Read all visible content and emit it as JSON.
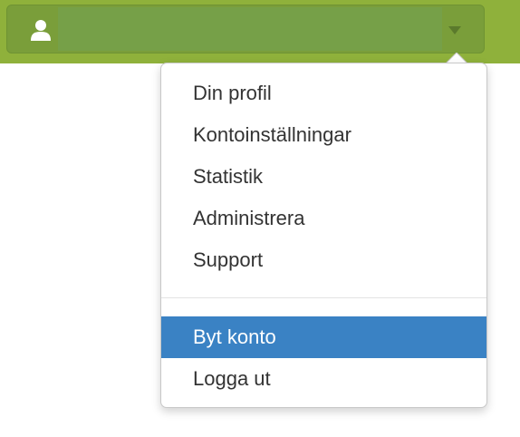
{
  "header": {
    "user_icon": "user-icon",
    "username": "",
    "caret_icon": "caret-down-icon",
    "colors": {
      "bar": "#8fb13b",
      "button": "#7a9e3a",
      "name_field": "#76a048"
    }
  },
  "menu": {
    "items": [
      {
        "label": "Din profil"
      },
      {
        "label": "Kontoinställningar"
      },
      {
        "label": "Statistik"
      },
      {
        "label": "Administrera"
      },
      {
        "label": "Support"
      }
    ],
    "secondary_items": [
      {
        "label": "Byt konto",
        "highlighted": true
      },
      {
        "label": "Logga ut",
        "highlighted": false
      }
    ],
    "colors": {
      "highlight": "#3a82c4",
      "text": "#333333"
    }
  }
}
